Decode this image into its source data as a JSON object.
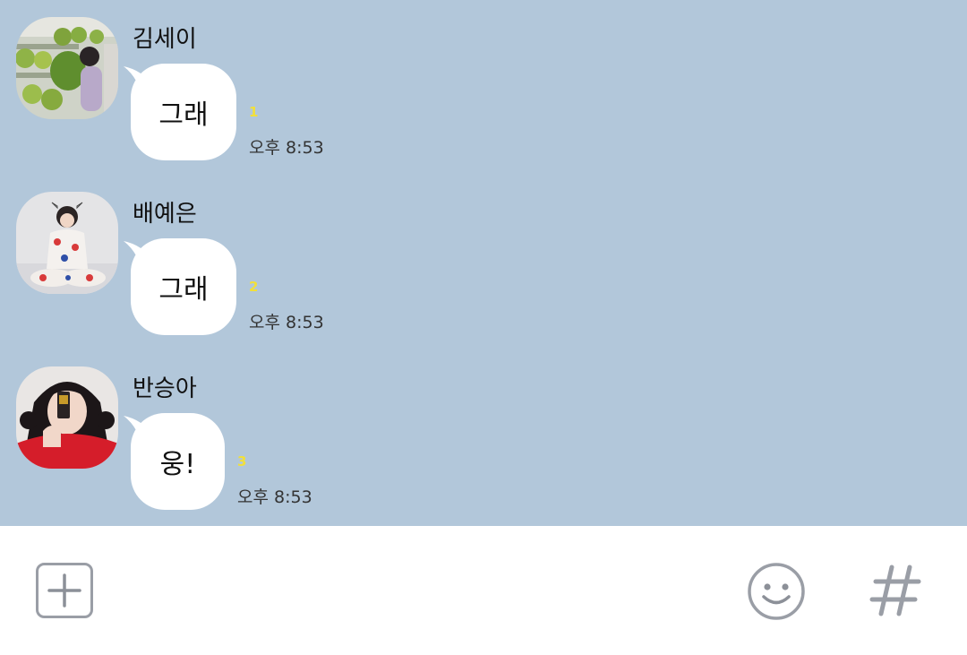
{
  "colors": {
    "chat_background": "#b2c7da",
    "bubble": "#ffffff",
    "unread_count": "#f2e03a",
    "input_bar": "#ffffff",
    "icon_gray": "#9a9ea6"
  },
  "messages": [
    {
      "sender": "김세이",
      "text": "그래",
      "unread": "1",
      "time": "오후 8:53",
      "avatar_icon": "profile-photo-plush-store"
    },
    {
      "sender": "배예은",
      "text": "그래",
      "unread": "2",
      "time": "오후 8:53",
      "avatar_icon": "profile-photo-pajamas"
    },
    {
      "sender": "반승아",
      "text": "웅!",
      "unread": "3",
      "time": "오후 8:53",
      "avatar_icon": "profile-photo-red-sweater"
    }
  ],
  "input_bar": {
    "add_icon": "plus-square-icon",
    "message_placeholder": "",
    "emoji_icon": "smiley-icon",
    "hash_icon": "hashtag-icon"
  }
}
